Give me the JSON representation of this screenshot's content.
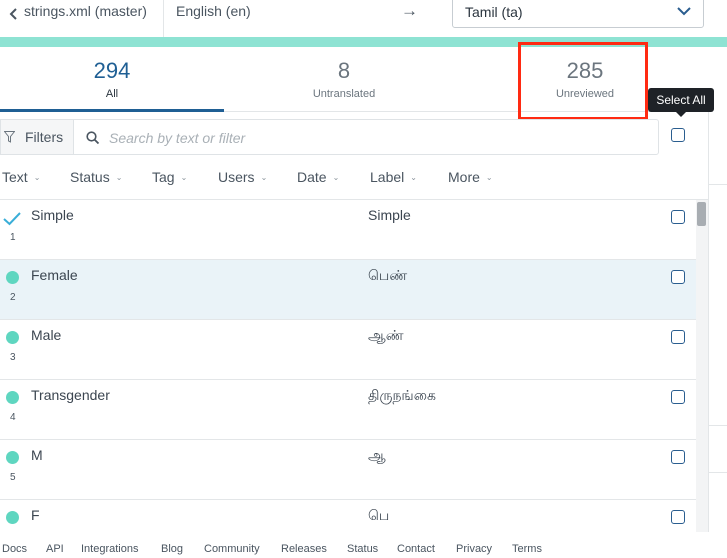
{
  "topbar": {
    "file_label": "strings.xml (master)",
    "source_language": "English (en)",
    "arrow": "→",
    "target_language": "Tamil (ta)"
  },
  "stats": {
    "all": {
      "count": "294",
      "label": "All"
    },
    "untranslated": {
      "count": "8",
      "label": "Untranslated"
    },
    "unreviewed": {
      "count": "285",
      "label": "Unreviewed"
    }
  },
  "tooltip": "Select All",
  "filters": {
    "button_label": "Filters",
    "search_placeholder": "Search by text or filter"
  },
  "sorts": [
    "Text",
    "Status",
    "Tag",
    "Users",
    "Date",
    "Label",
    "More"
  ],
  "rows": [
    {
      "index": "1",
      "source": "Simple",
      "translation": "Simple",
      "state": "check"
    },
    {
      "index": "2",
      "source": "Female",
      "translation": "பெண்",
      "state": "dot"
    },
    {
      "index": "3",
      "source": "Male",
      "translation": "ஆண்",
      "state": "dot"
    },
    {
      "index": "4",
      "source": "Transgender",
      "translation": "திருநங்கை",
      "state": "dot"
    },
    {
      "index": "5",
      "source": "M",
      "translation": "ஆ",
      "state": "dot"
    },
    {
      "index": "",
      "source": "F",
      "translation": "பெ",
      "state": "dot"
    }
  ],
  "footer": [
    "Docs",
    "API",
    "Integrations",
    "Blog",
    "Community",
    "Releases",
    "Status",
    "Contact",
    "Privacy",
    "Terms"
  ],
  "colors": {
    "accent": "#1f5f94",
    "progress": "#8ee3d3",
    "dot": "#5fd6c0",
    "highlight_box": "#ff2a12",
    "selected_row": "#eaf3f8"
  }
}
